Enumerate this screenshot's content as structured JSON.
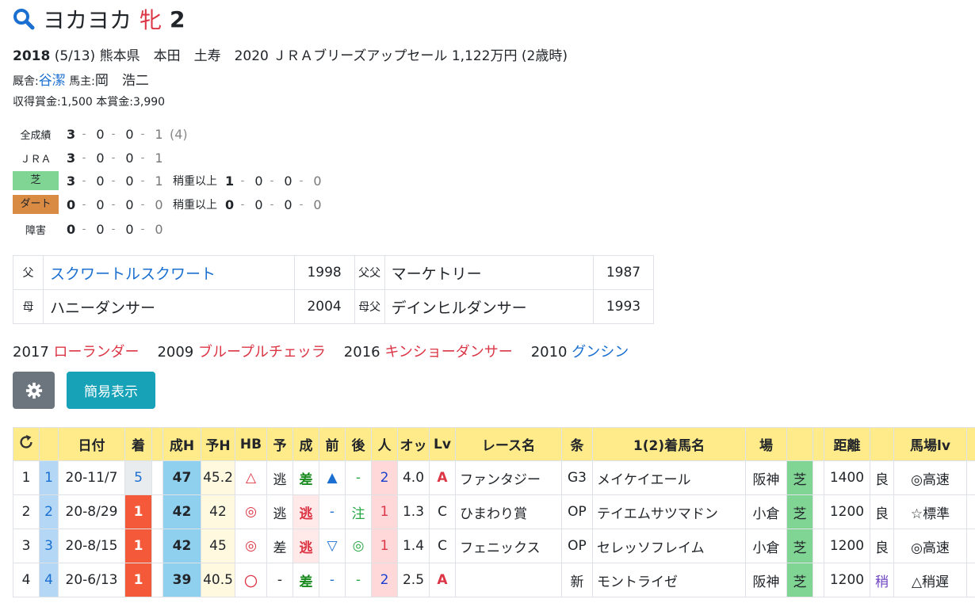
{
  "horse": {
    "name": "ヨカヨカ",
    "sex": "牝",
    "age": "2"
  },
  "info": {
    "year": "2018",
    "birthdate": "(5/13)",
    "origin": "熊本県　本田　土寿　2020 ＪＲＡブリーズアップセール 1,122万円 (2歳時)",
    "stable_label": "厩舎:",
    "trainer": "谷潔",
    "owner_label": "馬主:",
    "owner": "岡　浩二",
    "earnings": "収得賞金:1,500",
    "prize": "本賞金:3,990"
  },
  "records": {
    "all": {
      "label": "全成績",
      "vals": [
        "3",
        "0",
        "0",
        "1"
      ],
      "extra": "(4)"
    },
    "jra": {
      "label": "ＪＲＡ",
      "vals": [
        "3",
        "0",
        "0",
        "1"
      ]
    },
    "turf": {
      "label": "芝",
      "vals": [
        "3",
        "0",
        "0",
        "1"
      ],
      "sub_label": "稍重以上",
      "sub": [
        "1",
        "0",
        "0",
        "0"
      ]
    },
    "dirt": {
      "label": "ダート",
      "vals": [
        "0",
        "0",
        "0",
        "0"
      ],
      "sub_label": "稍重以上",
      "sub": [
        "0",
        "0",
        "0",
        "0"
      ]
    },
    "steeple": {
      "label": "障害",
      "vals": [
        "0",
        "0",
        "0",
        "0"
      ]
    }
  },
  "pedigree": {
    "sire_label": "父",
    "sire": "スクワートルスクワート",
    "sire_year": "1998",
    "sire_sire_label": "父父",
    "sire_sire": "マーケトリー",
    "sire_sire_year": "1987",
    "dam_label": "母",
    "dam": "ハニーダンサー",
    "dam_year": "2004",
    "dam_sire_label": "母父",
    "dam_sire": "デインヒルダンサー",
    "dam_sire_year": "1993"
  },
  "siblings": [
    {
      "year": "2017",
      "name": "ローランダー",
      "color": "red"
    },
    {
      "year": "2009",
      "name": "ブループルチェッラ",
      "color": "red"
    },
    {
      "year": "2016",
      "name": "キンショーダンサー",
      "color": "red"
    },
    {
      "year": "2010",
      "name": "グンシン",
      "color": "blue"
    }
  ],
  "buttons": {
    "simple": "簡易表示",
    "gear_icon": "gear-icon",
    "refresh_icon": "refresh-icon"
  },
  "table": {
    "headers": [
      "",
      "",
      "日付",
      "着",
      "",
      "成H",
      "予H",
      "HB",
      "予",
      "成",
      "前",
      "後",
      "人",
      "オッ",
      "Lv",
      "レース名",
      "条",
      "1(2)着馬名",
      "場",
      "",
      "",
      "距離",
      "",
      "馬場lv",
      ""
    ],
    "rows": [
      {
        "no": "1",
        "idx": "1",
        "date": "20-11/7",
        "rank": "5",
        "score": "47",
        "pred": "45.2",
        "hb": "△",
        "yo": "逃",
        "res": "差",
        "front": "▲",
        "back": "-",
        "pop": "2",
        "odds": "4.0",
        "lv": "A",
        "race": "ファンタジー",
        "cond": "G3",
        "winner": "メイケイエール",
        "place": "阪神",
        "surface": "芝",
        "dist": "1400",
        "going": "良",
        "track": "◎高速"
      },
      {
        "no": "2",
        "idx": "2",
        "date": "20-8/29",
        "rank": "1",
        "score": "42",
        "pred": "42",
        "hb": "◎",
        "yo": "逃",
        "res": "逃",
        "front": "-",
        "back": "注",
        "pop": "1",
        "odds": "1.3",
        "lv": "C",
        "race": "ひまわり賞",
        "cond": "OP",
        "winner": "テイエムサツマドン",
        "place": "小倉",
        "surface": "芝",
        "dist": "1200",
        "going": "良",
        "track": "☆標準"
      },
      {
        "no": "3",
        "idx": "3",
        "date": "20-8/15",
        "rank": "1",
        "score": "42",
        "pred": "45",
        "hb": "◎",
        "yo": "差",
        "res": "逃",
        "front": "▽",
        "back": "◎",
        "pop": "1",
        "odds": "1.4",
        "lv": "C",
        "race": "フェニックス",
        "cond": "OP",
        "winner": "セレッソフレイム",
        "place": "小倉",
        "surface": "芝",
        "dist": "1200",
        "going": "良",
        "track": "◎高速"
      },
      {
        "no": "4",
        "idx": "4",
        "date": "20-6/13",
        "rank": "1",
        "score": "39",
        "pred": "40.5",
        "hb": "〇",
        "yo": "-",
        "res": "差",
        "front": "-",
        "back": "-",
        "pop": "2",
        "odds": "2.5",
        "lv": "A",
        "race": "",
        "cond": "新",
        "winner": "モントライゼ",
        "place": "阪神",
        "surface": "芝",
        "dist": "1200",
        "going": "稍",
        "track": "△稍遅"
      }
    ]
  }
}
